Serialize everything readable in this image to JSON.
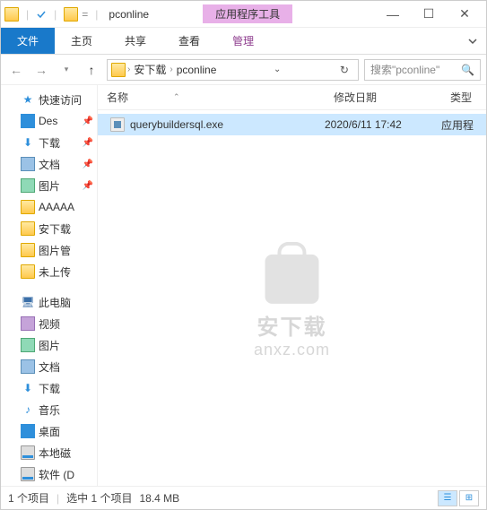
{
  "titlebar": {
    "title": "pconline",
    "context_tab": "应用程序工具"
  },
  "ribbon": {
    "file": "文件",
    "home": "主页",
    "share": "共享",
    "view": "查看",
    "manage": "管理"
  },
  "address": {
    "crumb1": "安下载",
    "crumb2": "pconline"
  },
  "search": {
    "placeholder": "搜索\"pconline\""
  },
  "sidebar": {
    "quick": "快速访问",
    "items": [
      {
        "label": "Des"
      },
      {
        "label": "下载"
      },
      {
        "label": "文档"
      },
      {
        "label": "图片"
      },
      {
        "label": "AAAAA"
      },
      {
        "label": "安下载"
      },
      {
        "label": "图片管"
      },
      {
        "label": "未上传"
      }
    ],
    "thispc": "此电脑",
    "pcitems": [
      {
        "label": "视频"
      },
      {
        "label": "图片"
      },
      {
        "label": "文档"
      },
      {
        "label": "下载"
      },
      {
        "label": "音乐"
      },
      {
        "label": "桌面"
      },
      {
        "label": "本地磁"
      },
      {
        "label": "软件 (D"
      }
    ]
  },
  "columns": {
    "name": "名称",
    "date": "修改日期",
    "type": "类型"
  },
  "file": {
    "name": "querybuildersql.exe",
    "date": "2020/6/11 17:42",
    "type": "应用程"
  },
  "watermark": {
    "line1": "安下载",
    "line2": "anxz.com"
  },
  "status": {
    "count": "1 个项目",
    "selected": "选中 1 个项目",
    "size": "18.4 MB"
  }
}
